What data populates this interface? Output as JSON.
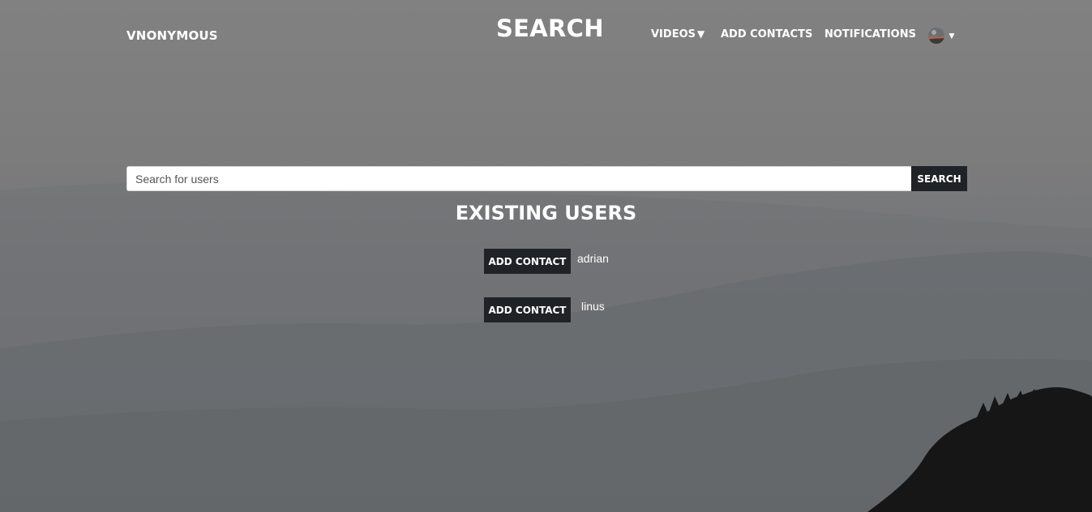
{
  "brand": "VNONYMOUS",
  "page_title": "SEARCH",
  "nav": {
    "videos_label": "VIDEOS",
    "videos_caret": "▼",
    "add_contacts_label": "ADD CONTACTS",
    "notifications_label": "NOTIFICATIONS",
    "profile_caret": "▼"
  },
  "search": {
    "placeholder": "Search for users",
    "value": "",
    "button_label": "SEARCH"
  },
  "users_section": {
    "title": "EXISTING USERS",
    "users": [
      {
        "button_label": "ADD CONTACT",
        "username": "adrian"
      },
      {
        "button_label": "ADD CONTACT",
        "username": "linus"
      }
    ]
  },
  "icons": {
    "caret": "chevron-down-icon",
    "avatar": "avatar"
  },
  "colors": {
    "button_bg": "#1f2226",
    "text": "#ffffff",
    "background": "#7a7b7d"
  }
}
